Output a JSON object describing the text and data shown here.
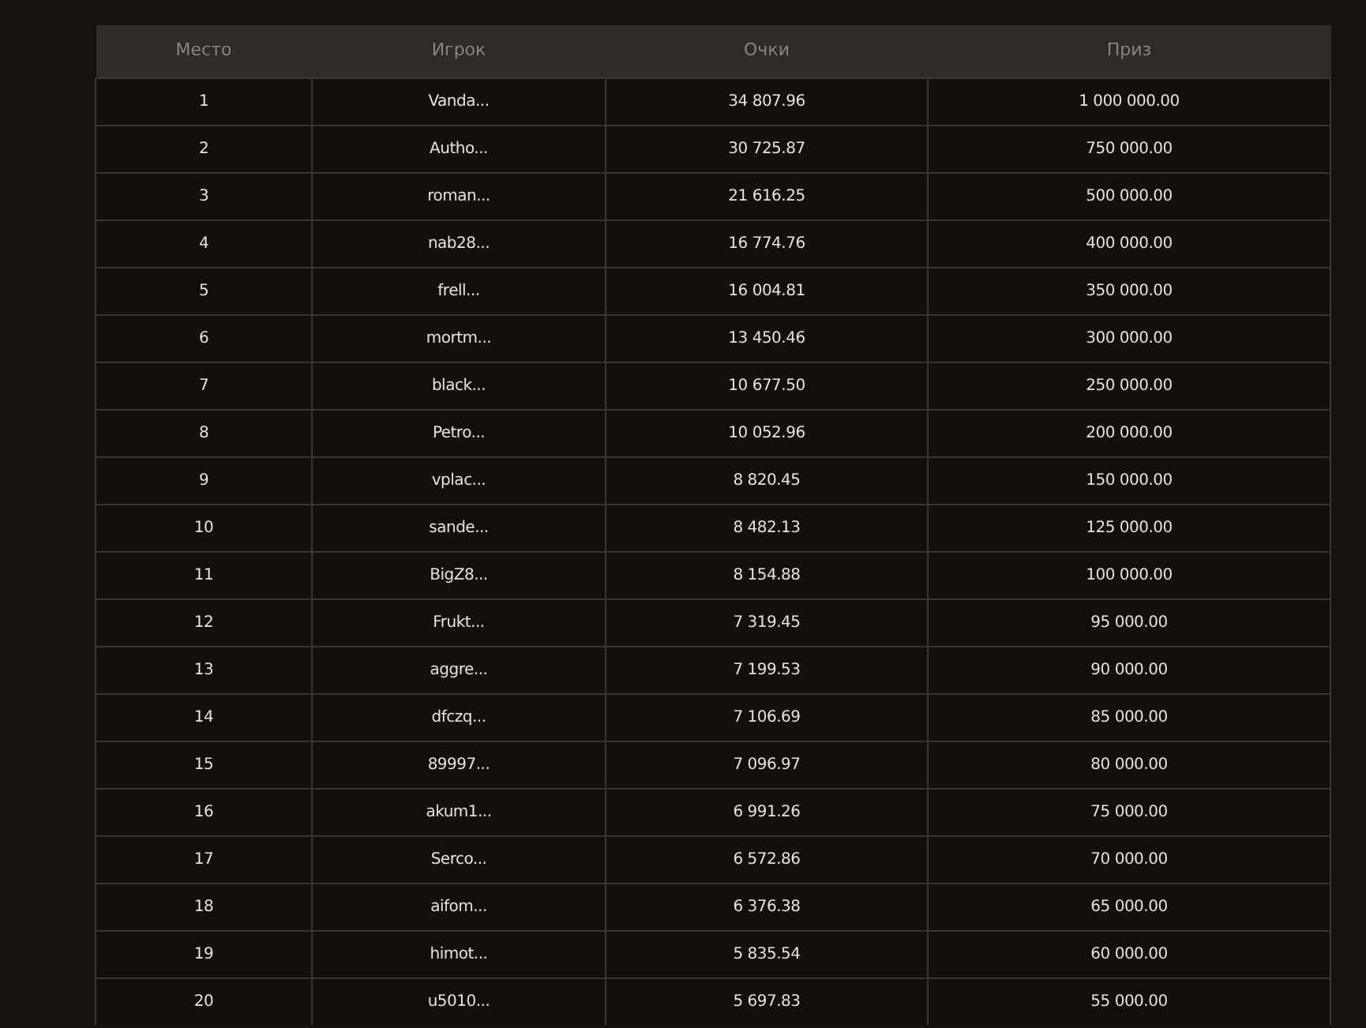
{
  "table": {
    "columns": [
      "Место",
      "Игрок",
      "Очки",
      "Приз"
    ],
    "rows": [
      [
        "1",
        "Vanda...",
        "34 807.96",
        "1 000 000.00"
      ],
      [
        "2",
        "Autho...",
        "30 725.87",
        "750 000.00"
      ],
      [
        "3",
        "roman...",
        "21 616.25",
        "500 000.00"
      ],
      [
        "4",
        "nab28...",
        "16 774.76",
        "400 000.00"
      ],
      [
        "5",
        "frell...",
        "16 004.81",
        "350 000.00"
      ],
      [
        "6",
        "mortm...",
        "13 450.46",
        "300 000.00"
      ],
      [
        "7",
        "black...",
        "10 677.50",
        "250 000.00"
      ],
      [
        "8",
        "Petro...",
        "10 052.96",
        "200 000.00"
      ],
      [
        "9",
        "vplac...",
        "8 820.45",
        "150 000.00"
      ],
      [
        "10",
        "sande...",
        "8 482.13",
        "125 000.00"
      ],
      [
        "11",
        "BigZ8...",
        "8 154.88",
        "100 000.00"
      ],
      [
        "12",
        "Frukt...",
        "7 319.45",
        "95 000.00"
      ],
      [
        "13",
        "aggre...",
        "7 199.53",
        "90 000.00"
      ],
      [
        "14",
        "dfczq...",
        "7 106.69",
        "85 000.00"
      ],
      [
        "15",
        "89997...",
        "7 096.97",
        "80 000.00"
      ],
      [
        "16",
        "akum1...",
        "6 991.26",
        "75 000.00"
      ],
      [
        "17",
        "Serco...",
        "6 572.86",
        "70 000.00"
      ],
      [
        "18",
        "aifom...",
        "6 376.38",
        "65 000.00"
      ],
      [
        "19",
        "himot...",
        "5 835.54",
        "60 000.00"
      ],
      [
        "20",
        "u5010...",
        "5 697.83",
        "55 000.00"
      ]
    ]
  }
}
